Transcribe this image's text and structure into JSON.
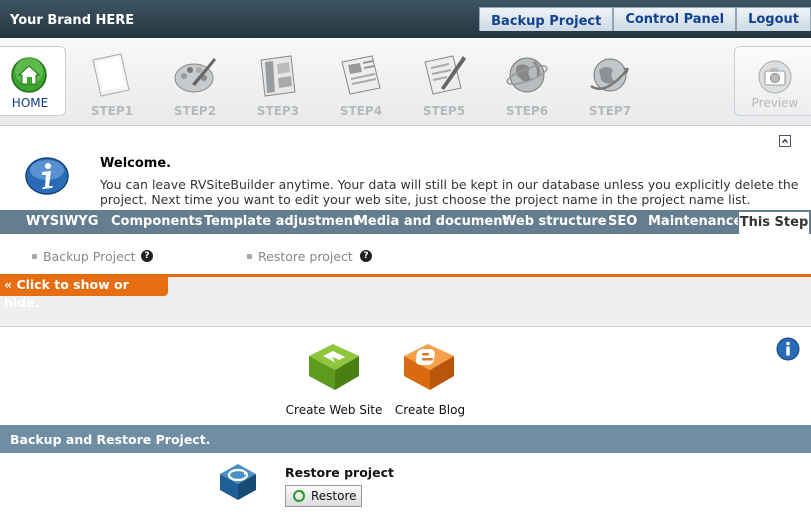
{
  "header": {
    "brand": "Your Brand HERE",
    "links": [
      "Backup Project",
      "Control Panel",
      "Logout"
    ]
  },
  "steps": {
    "home": "HOME",
    "items": [
      "STEP1",
      "STEP2",
      "STEP3",
      "STEP4",
      "STEP5",
      "STEP6",
      "STEP7"
    ],
    "preview": "Preview"
  },
  "welcome": {
    "title": "Welcome.",
    "text": "You can leave RVSiteBuilder anytime. Your data will still be kept in our database unless you explicitly delete the project. Next time you want to edit your web site, just choose the project name in the project name list."
  },
  "menu": {
    "items": [
      "WYSIWYG",
      "Components",
      "Template adjustment",
      "Media and document",
      "Web structure",
      "SEO",
      "Maintenance"
    ],
    "active": "This Step"
  },
  "sub_links": [
    "Backup Project",
    "Restore project"
  ],
  "toggle_label": "Click to show or hide.",
  "create": {
    "site": "Create Web Site",
    "blog": "Create Blog"
  },
  "section": {
    "title": "Backup and Restore Project.",
    "restore_title": "Restore project",
    "restore_button": "Restore"
  },
  "colors": {
    "header_bg": "#2b3d48",
    "link_text": "#10428f",
    "menu_bg": "#647d8f",
    "accent_orange": "#e76d12",
    "section_bg": "#6f8da3"
  },
  "icons": {
    "home": "home-icon",
    "preview": "camera-icon",
    "info": "info-icon",
    "create_site": "create-site-icon",
    "create_blog": "blogger-icon",
    "restore": "restore-icon"
  }
}
